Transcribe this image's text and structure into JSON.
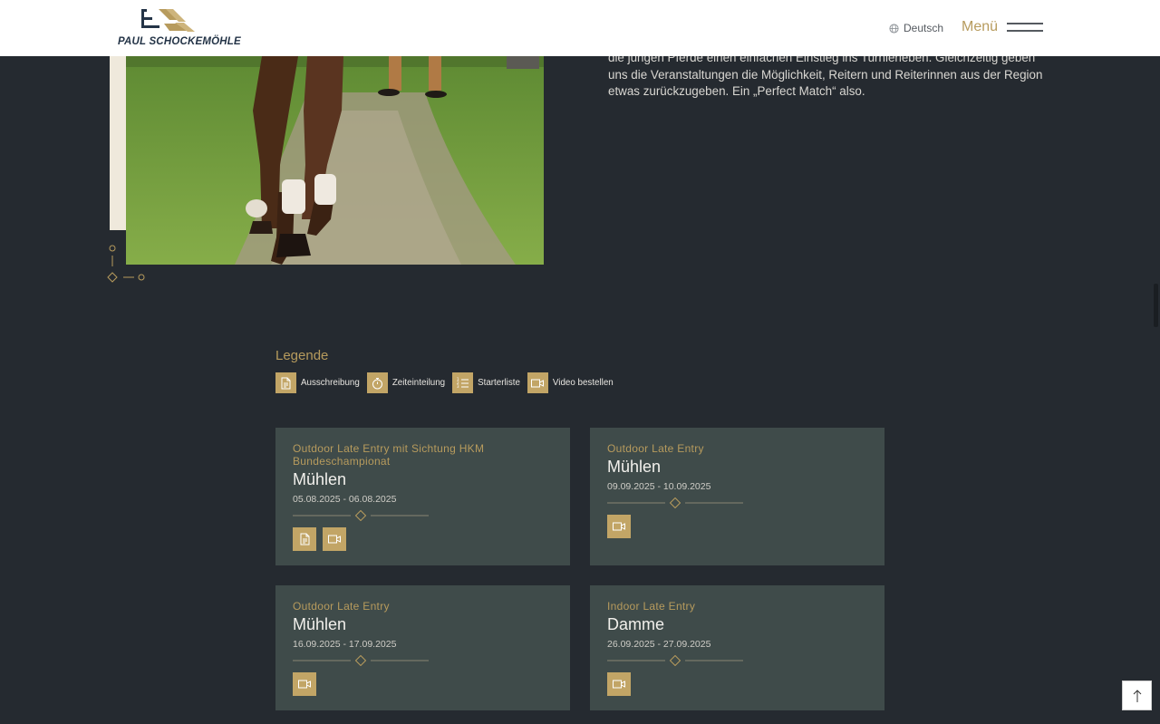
{
  "header": {
    "logo_text": "PAUL SCHOCKEMÖHLE",
    "language_label": "Deutsch",
    "menu_label": "Menü"
  },
  "intro": {
    "lines": [
      "die jungen Pferde einen einfachen Einstieg ins Turnierleben. Gleichzeitig geben",
      "uns die Veranstaltungen die Möglichkeit, Reitern und Reiterinnen aus der Region",
      "etwas zurückzugeben. Ein „Perfect Match“ also."
    ]
  },
  "legend": {
    "title": "Legende",
    "items": [
      {
        "label": "Ausschreibung",
        "icon": "document-icon"
      },
      {
        "label": "Zeiteinteilung",
        "icon": "stopwatch-icon"
      },
      {
        "label": "Starterliste",
        "icon": "list-icon"
      },
      {
        "label": "Video bestellen",
        "icon": "video-icon"
      }
    ]
  },
  "events": [
    {
      "category": "Outdoor Late Entry mit Sichtung HKM Bundeschampionat",
      "place": "Mühlen",
      "dates": "05.08.2025 - 06.08.2025",
      "icons": [
        "document-icon",
        "video-icon"
      ]
    },
    {
      "category": "Outdoor Late Entry",
      "place": "Mühlen",
      "dates": "09.09.2025 - 10.09.2025",
      "icons": [
        "video-icon"
      ]
    },
    {
      "category": "Outdoor Late Entry",
      "place": "Mühlen",
      "dates": "16.09.2025 - 17.09.2025",
      "icons": [
        "video-icon"
      ]
    },
    {
      "category": "Indoor Late Entry",
      "place": "Damme",
      "dates": "26.09.2025 - 27.09.2025",
      "icons": [
        "video-icon"
      ]
    }
  ],
  "colors": {
    "background": "#252a30",
    "card": "#3f4b4a",
    "gold": "#b79b5d",
    "icon_tile": "#c2a566",
    "header": "#ffffff"
  }
}
